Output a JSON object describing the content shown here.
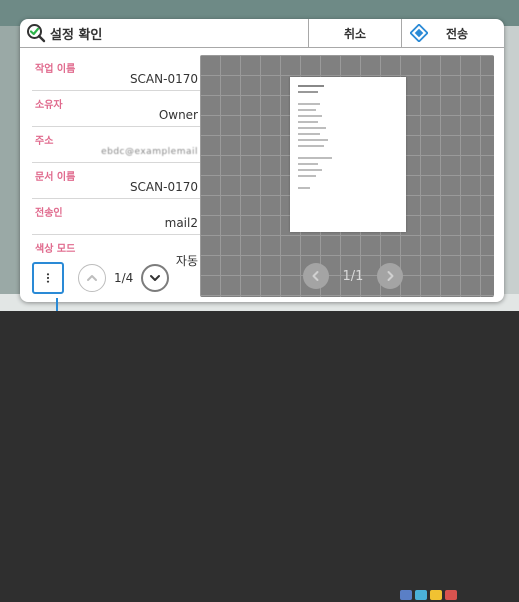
{
  "dialog": {
    "title": "설정 확인",
    "cancel_label": "취소",
    "send_label": "전송"
  },
  "info_rows": [
    {
      "label": "작업 이름",
      "value": "SCAN-0170"
    },
    {
      "label": "소유자",
      "value": "Owner"
    },
    {
      "label": "주소",
      "value": "ebdc@examplemail"
    },
    {
      "label": "문서 이름",
      "value": "SCAN-0170"
    },
    {
      "label": "전송인",
      "value": "mail2"
    },
    {
      "label": "색상 모드",
      "value": "자동"
    }
  ],
  "pagination": {
    "page_indicator": "1/4"
  },
  "preview": {
    "page_indicator": "1/1"
  },
  "colors": {
    "label_pink": "#e06a8d",
    "accent_blue": "#2a8ad6",
    "preview_bg": "#808080"
  },
  "icons": {
    "title": "check-magnifier-icon",
    "send": "send-diamond-icon",
    "menu": "more-vertical-icon",
    "up": "chevron-up-icon",
    "down": "chevron-down-icon",
    "prev": "chevron-left-icon",
    "next": "chevron-right-icon"
  }
}
